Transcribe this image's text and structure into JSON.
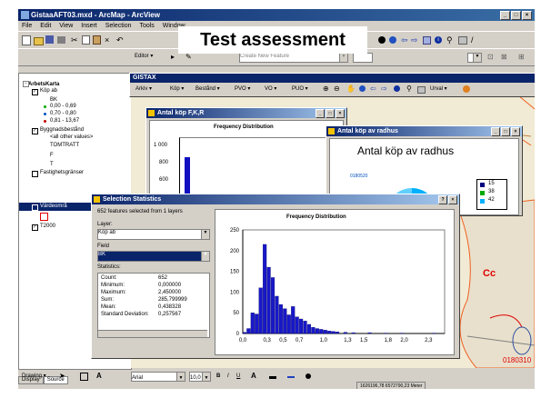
{
  "app": {
    "title": "GistaaAFT03.mxd - ArcMap - ArcView",
    "menu": [
      "File",
      "Edit",
      "View",
      "Insert",
      "Selection",
      "Tools",
      "Window"
    ]
  },
  "banner": {
    "text": "Test assessment"
  },
  "editor": {
    "label": "Editor ▾",
    "task": "Create New Feature"
  },
  "gistax": {
    "title": "GISTAX",
    "items": [
      "Arkiv ▾",
      "Köp ▾",
      "Bestånd ▾",
      "PVO ▾",
      "VO ▾",
      "PUO ▾",
      "Urval ▾"
    ]
  },
  "toc": {
    "root": "ArbetsKarta",
    "layers": [
      {
        "name": "Köp ab"
      },
      {
        "name": "BK"
      },
      {
        "name": "0,00 - 0,69"
      },
      {
        "name": "0,70 - 0,80"
      },
      {
        "name": "0,81 - 13,67"
      },
      {
        "name": "Byggnadsbestånd"
      },
      {
        "name": "<all other values>"
      },
      {
        "name": "TOMTRATT"
      },
      {
        "name": "F"
      },
      {
        "name": "T"
      },
      {
        "name": "Fastighetsgränser"
      },
      {
        "name": "Värdeområ"
      },
      {
        "name": "T2000"
      }
    ]
  },
  "tabs": {
    "display": "Display",
    "source": "Source"
  },
  "win_fkr": {
    "title": "Antal köp F,K,R",
    "chart_title": "Frequency Distribution",
    "yticks": [
      "1 000",
      "800",
      "600",
      "400"
    ]
  },
  "win_radhus": {
    "title": "Antal köp av radhus",
    "chart_title": "Antal köp av radhus",
    "slice_label": "0180520",
    "legend": [
      {
        "label": "15",
        "color": "#000080"
      },
      {
        "label": "38",
        "color": "#00aa00"
      },
      {
        "label": "42",
        "color": "#00b0ff"
      }
    ]
  },
  "stats": {
    "title": "Selection Statistics",
    "summary": "652 features selected from 1 layers",
    "layer_label": "Layer:",
    "layer_value": "Köp ab",
    "field_label": "Field",
    "field_value": "BK",
    "statistics_label": "Statistics:",
    "rows": [
      {
        "name": "Count:",
        "value": "652"
      },
      {
        "name": "Minimum:",
        "value": "0,000000"
      },
      {
        "name": "Maximum:",
        "value": "2,450000"
      },
      {
        "name": "Sum:",
        "value": "285,799999"
      },
      {
        "name": "Mean:",
        "value": "0,438328"
      },
      {
        "name": "Standard Deviation:",
        "value": "0,257567"
      }
    ]
  },
  "chart_data": {
    "type": "bar",
    "title": "Frequency Distribution",
    "x": [
      0.05,
      0.1,
      0.15,
      0.2,
      0.25,
      0.3,
      0.35,
      0.4,
      0.45,
      0.5,
      0.55,
      0.6,
      0.65,
      0.7,
      0.75,
      0.8,
      0.85,
      0.9,
      0.95,
      1.0,
      1.05,
      1.1,
      1.15,
      1.2,
      1.3,
      1.4,
      1.6,
      1.8,
      2.0,
      2.4
    ],
    "values": [
      3,
      12,
      50,
      47,
      110,
      215,
      160,
      135,
      90,
      70,
      60,
      45,
      65,
      40,
      35,
      30,
      22,
      15,
      12,
      10,
      8,
      6,
      5,
      4,
      3,
      2,
      2,
      1,
      1,
      1
    ],
    "xticks": [
      "0,0",
      "0,3",
      "0,5",
      "0,7",
      "1,0",
      "1,3",
      "1,5",
      "1,8",
      "2,0",
      "2,3"
    ],
    "yticks": [
      "250",
      "200",
      "150",
      "100",
      "50",
      "0"
    ],
    "ylim": [
      0,
      250
    ],
    "xlim": [
      0,
      2.5
    ]
  },
  "map": {
    "label_cc": "Cc",
    "tile_number": "0180310"
  },
  "drawbar": {
    "label": "Drawing ▾",
    "font": "Arial",
    "size": "10,0"
  },
  "status": {
    "coords": "1626196,78  6572790,23 Meter"
  }
}
